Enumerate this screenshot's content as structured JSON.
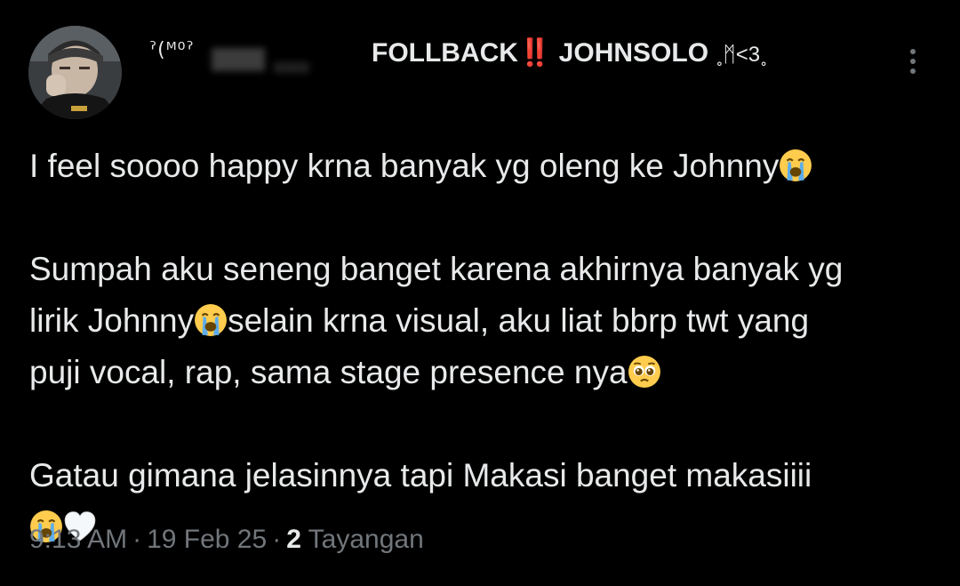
{
  "tweet": {
    "author": {
      "handle_glyphs": "ˀ(ᴹ⁰ˀ",
      "display_name_prefix": "FOLLBACK",
      "display_name_mark": "‼️",
      "display_name_main": " JOHNSOLO ",
      "display_name_tail": "˳ᛗ<3˳"
    },
    "lines": {
      "p1_text": "I feel soooo happy krna banyak yg oleng ke Johnny",
      "p2_line1": "Sumpah aku seneng banget karena akhirnya banyak yg",
      "p2_line2_a": "lirik Johnny",
      "p2_line2_b": "selain krna visual, aku liat bbrp twt yang",
      "p2_line3": "puji vocal, rap, sama stage presence nya",
      "p3_line1": "Gatau gimana jelasinnya tapi Makasi banget makasiiii"
    },
    "icons": {
      "crying": "loudly-crying-face-icon",
      "pleading": "pleading-face-icon",
      "heart": "white-heart-icon",
      "more": "more-options-icon"
    },
    "meta": {
      "time": "9:13 AM",
      "dot1": "·",
      "date": "19 Feb 25",
      "dot2": "·",
      "views_count": "2",
      "views_label": "Tayangan"
    },
    "colors": {
      "background": "#000000",
      "text": "#e7e9ea",
      "muted": "#71767b",
      "accent_red": "#e0262c"
    }
  }
}
